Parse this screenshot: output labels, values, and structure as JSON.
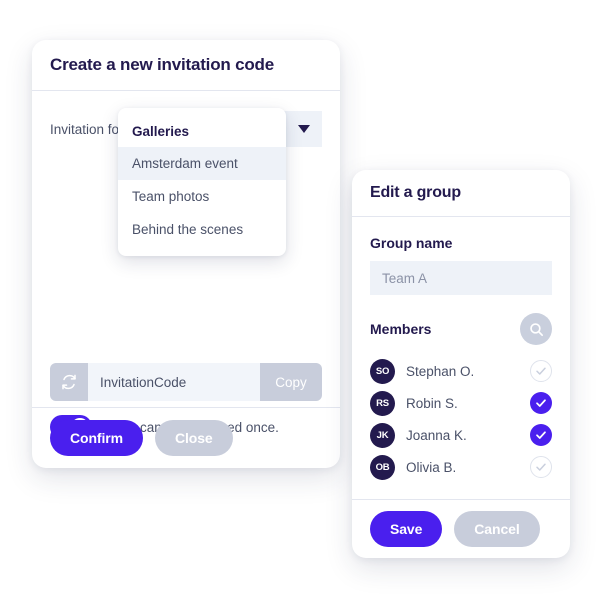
{
  "theme": {
    "accent": "#4a1fee",
    "muted": "#c8cddb",
    "field_bg": "#eef2f8",
    "text_dark": "#231a4e",
    "text_body": "#4a5168",
    "divider": "#e3e6ef"
  },
  "invitation_card": {
    "title": "Create a new invitation code",
    "field_label": "Invitation for",
    "select": {
      "value": "",
      "placeholder": "",
      "caret_icon": "chevron-down-icon"
    },
    "dropdown": {
      "group_label": "Galleries",
      "items": [
        {
          "label": "Amsterdam event",
          "highlighted": true
        },
        {
          "label": "Team photos",
          "highlighted": false
        },
        {
          "label": "Behind the scenes",
          "highlighted": false
        }
      ]
    },
    "code": {
      "refresh_icon": "refresh-icon",
      "value": "InvitationCode",
      "copy_label": "Copy"
    },
    "toggle": {
      "label": "Code can only be used once.",
      "state": "on"
    },
    "footer": {
      "confirm_label": "Confirm",
      "close_label": "Close"
    }
  },
  "group_card": {
    "title": "Edit a group",
    "group_name_label": "Group name",
    "group_name_input": {
      "value": "",
      "placeholder": "Team A"
    },
    "members_label": "Members",
    "search_icon": "search-icon",
    "members": [
      {
        "initials": "SO",
        "name": "Stephan O.",
        "selected": false
      },
      {
        "initials": "RS",
        "name": "Robin S.",
        "selected": true
      },
      {
        "initials": "JK",
        "name": "Joanna K.",
        "selected": true
      },
      {
        "initials": "OB",
        "name": "Olivia B.",
        "selected": false
      }
    ],
    "footer": {
      "save_label": "Save",
      "cancel_label": "Cancel"
    }
  }
}
